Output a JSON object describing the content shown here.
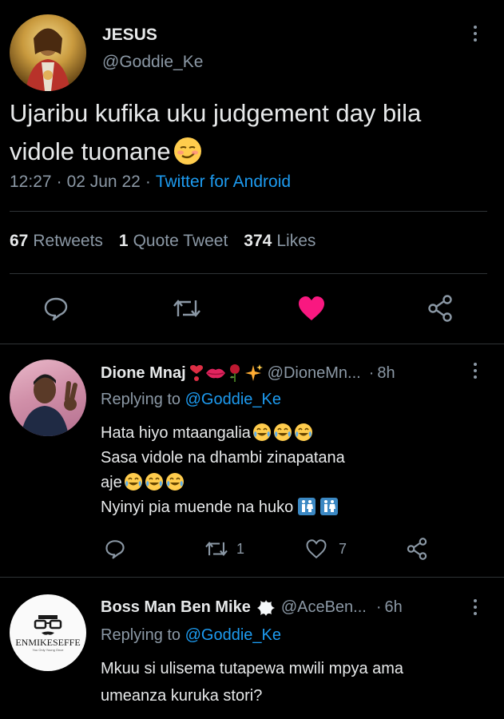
{
  "main_tweet": {
    "display_name": "JESUS",
    "handle": "@Goddie_Ke",
    "text_line1": "Ujaribu kufika uku judgement day bila",
    "text_line2": "vidole tuonane",
    "time": "12:27",
    "date": "02 Jun 22",
    "source": "Twitter for Android",
    "sep": "·",
    "stats": {
      "retweets_count": "67",
      "retweets_label": "Retweets",
      "quotes_count": "1",
      "quotes_label": "Quote Tweet",
      "likes_count": "374",
      "likes_label": "Likes"
    },
    "like_color": "#f91880"
  },
  "replies": [
    {
      "display_name": "Dione Mnaj",
      "handle": "@DioneMn...",
      "time": "8h",
      "replying_prefix": "Replying to",
      "replying_handle": "@Goddie_Ke",
      "lines": [
        "Hata hiyo mtaangalia",
        "Sasa vidole na dhambi zinapatana",
        "aje",
        "Nyinyi pia muende na huko"
      ],
      "retweets": "1",
      "likes": "7"
    },
    {
      "display_name": "Boss Man Ben Mike",
      "handle": "@AceBen...",
      "time": "6h",
      "replying_prefix": "Replying to",
      "replying_handle": "@Goddie_Ke",
      "lines": [
        "Mkuu si ulisema tutapewa mwili mpya ama",
        "umeanza kuruka stori?"
      ],
      "avatar_text": "ENMIKESEFFE",
      "avatar_subtext": "You Only Young Once"
    }
  ]
}
